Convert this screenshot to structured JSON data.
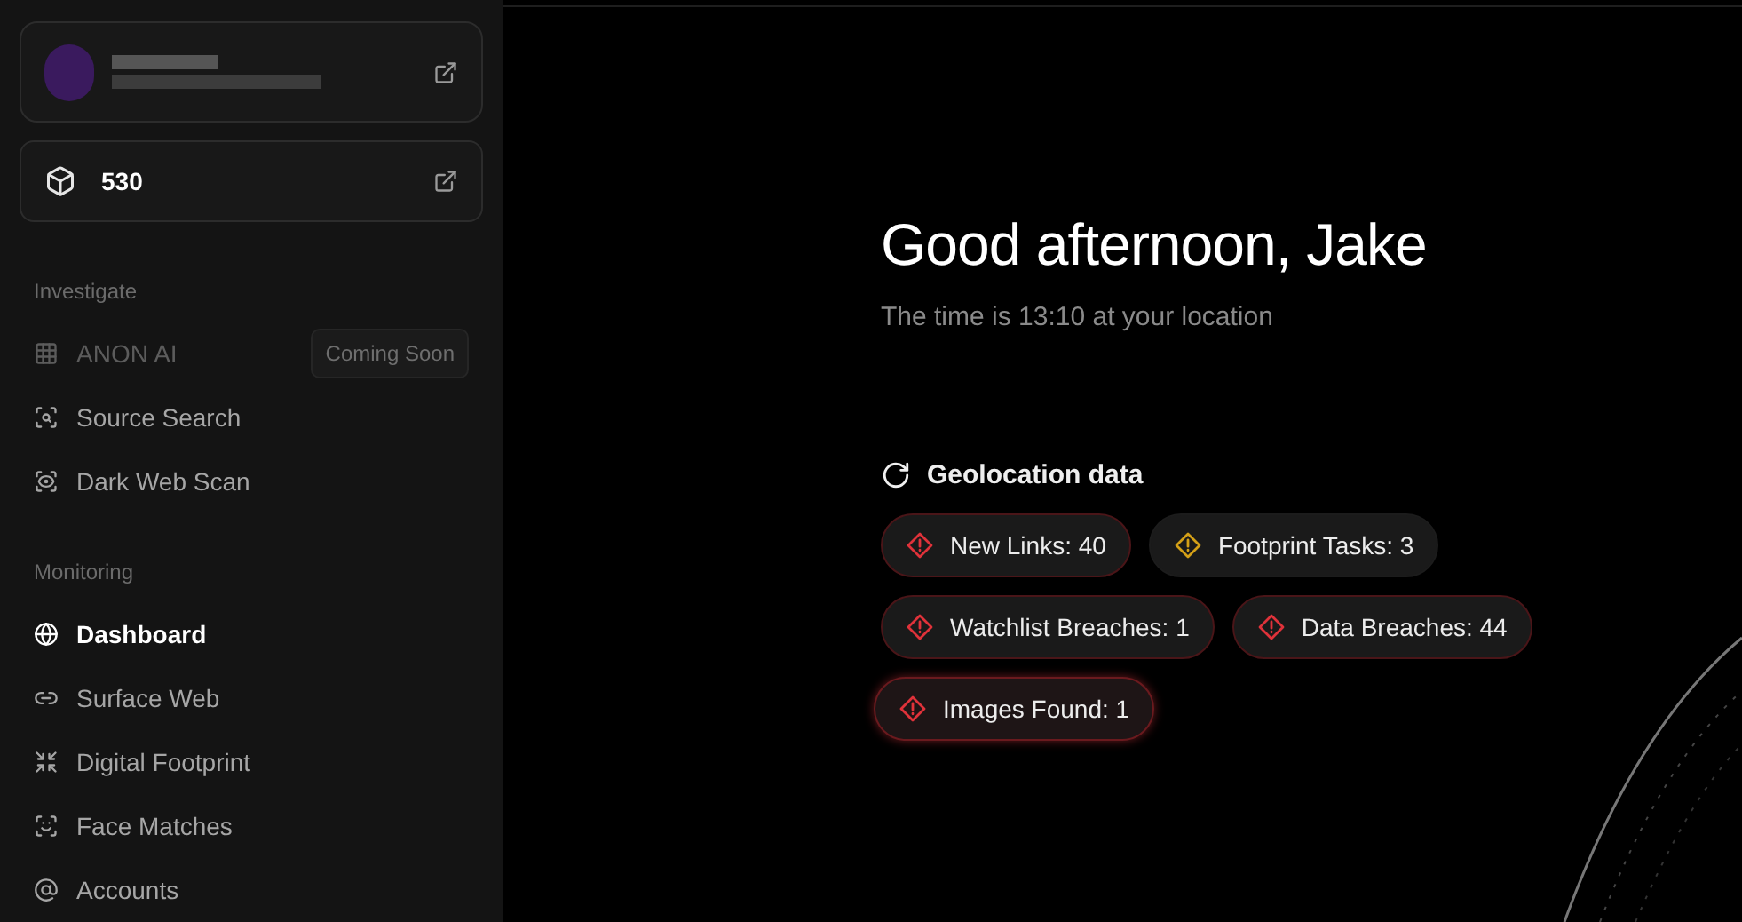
{
  "credits": {
    "value": "530"
  },
  "sidebar": {
    "sections": [
      {
        "title": "Investigate",
        "items": [
          {
            "label": "ANON AI",
            "disabled": true,
            "selected": false,
            "badge": "Coming Soon"
          },
          {
            "label": "Source Search",
            "disabled": false,
            "selected": false
          },
          {
            "label": "Dark Web Scan",
            "disabled": false,
            "selected": false
          }
        ]
      },
      {
        "title": "Monitoring",
        "items": [
          {
            "label": "Dashboard",
            "disabled": false,
            "selected": true
          },
          {
            "label": "Surface Web",
            "disabled": false,
            "selected": false
          },
          {
            "label": "Digital Footprint",
            "disabled": false,
            "selected": false
          },
          {
            "label": "Face Matches",
            "disabled": false,
            "selected": false
          },
          {
            "label": "Accounts",
            "disabled": false,
            "selected": false
          }
        ]
      }
    ]
  },
  "greeting": {
    "title": "Good afternoon, Jake",
    "subtitle": "The time is 13:10 at your location"
  },
  "geolocation": {
    "label": "Geolocation data"
  },
  "alerts": [
    {
      "label": "New Links: 40",
      "color": "#e0323a",
      "hovered": false
    },
    {
      "label": "Footprint Tasks: 3",
      "color": "#d4a017",
      "hovered": false
    },
    {
      "label": "Watchlist Breaches: 1",
      "color": "#e0323a",
      "hovered": false
    },
    {
      "label": "Data Breaches: 44",
      "color": "#e0323a",
      "hovered": false
    },
    {
      "label": "Images Found: 1",
      "color": "#e0323a",
      "hovered": true
    }
  ]
}
